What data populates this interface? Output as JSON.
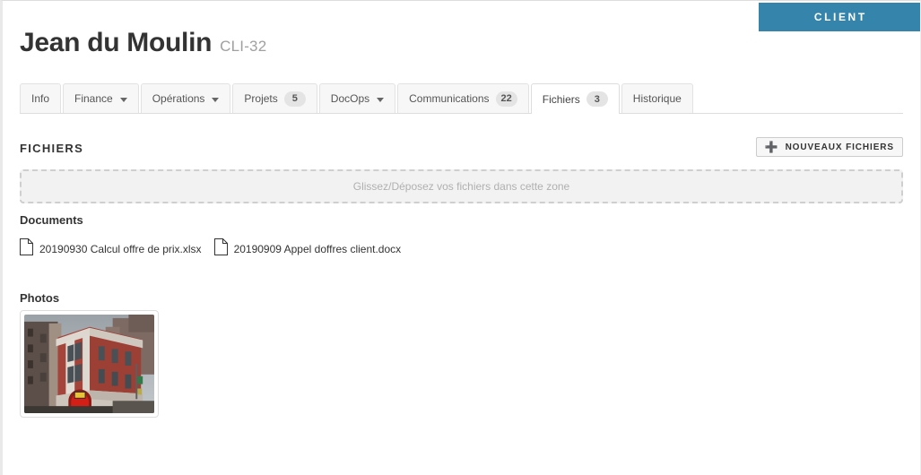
{
  "badge": {
    "label": "CLIENT",
    "color": "#3484ab"
  },
  "header": {
    "title": "Jean du Moulin",
    "reference": "CLI-32"
  },
  "tabs": [
    {
      "label": "Info",
      "count": null,
      "dropdown": false,
      "active": false
    },
    {
      "label": "Finance",
      "count": null,
      "dropdown": true,
      "active": false
    },
    {
      "label": "Opérations",
      "count": null,
      "dropdown": true,
      "active": false
    },
    {
      "label": "Projets",
      "count": "5",
      "dropdown": false,
      "active": false
    },
    {
      "label": "DocOps",
      "count": null,
      "dropdown": true,
      "active": false
    },
    {
      "label": "Communications",
      "count": "22",
      "dropdown": false,
      "active": false
    },
    {
      "label": "Fichiers",
      "count": "3",
      "dropdown": false,
      "active": true
    },
    {
      "label": "Historique",
      "count": null,
      "dropdown": false,
      "active": false
    }
  ],
  "section": {
    "title": "FICHIERS",
    "new_files_button": "NOUVEAUX FICHIERS",
    "plus_icon": "plus-icon"
  },
  "dropzone": {
    "text": "Glissez/Déposez vos fichiers dans cette zone"
  },
  "documents": {
    "heading": "Documents",
    "items": [
      {
        "name": "20190930 Calcul offre de prix.xlsx",
        "icon": "file-icon"
      },
      {
        "name": "20190909 Appel doffres client.docx",
        "icon": "file-icon"
      }
    ]
  },
  "photos": {
    "heading": "Photos",
    "items": [
      {
        "alt": "Photo de bâtiment en brique rouge",
        "icon": "photo-thumbnail"
      }
    ]
  }
}
